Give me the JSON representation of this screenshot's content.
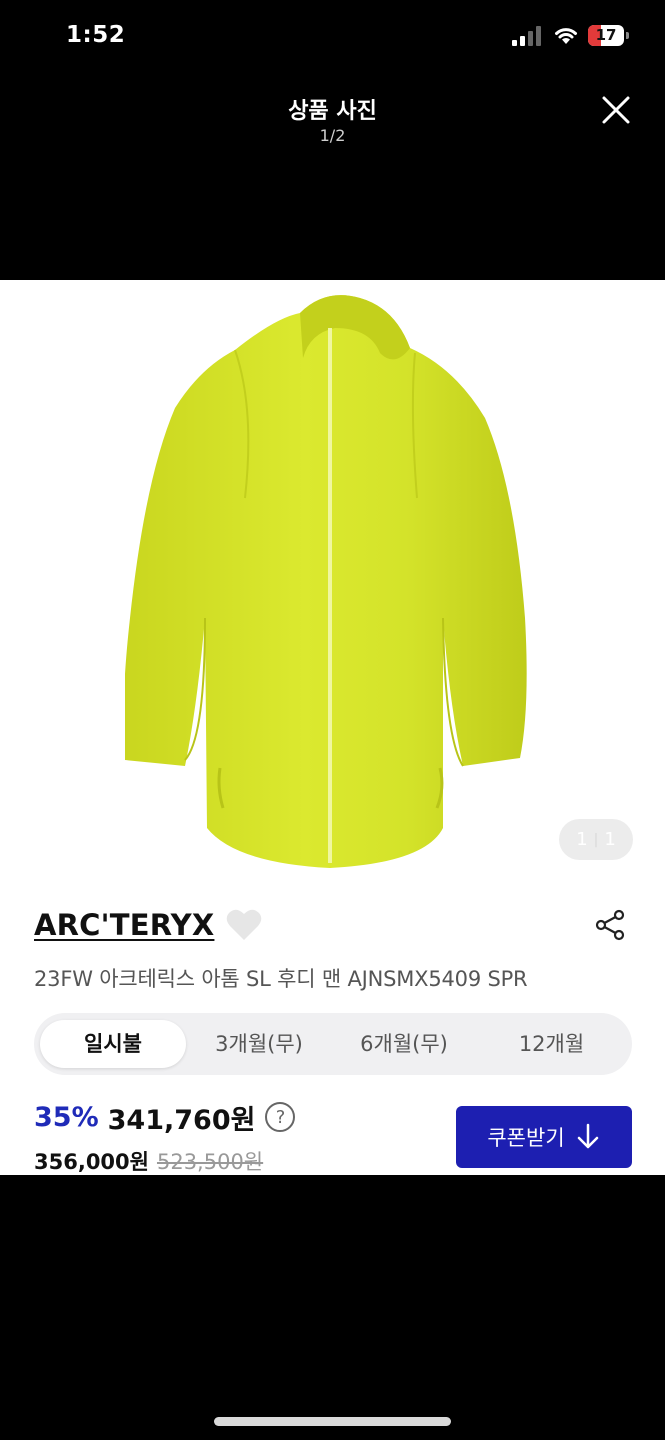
{
  "status_bar": {
    "time": "1:52",
    "battery": "17"
  },
  "viewer": {
    "title": "상품 사진",
    "counter": "1/2",
    "close_icon": "close-icon"
  },
  "product": {
    "image_counter": {
      "current": "1",
      "total": "1"
    },
    "image_color": "#d6e62a",
    "brand": "ARC'TERYX",
    "name": "23FW 아크테릭스 아톰 SL 후디 맨 AJNSMX5409 SPR",
    "payment_tabs": [
      "일시불",
      "3개월(무)",
      "6개월(무)",
      "12개월"
    ],
    "active_tab": "일시불",
    "discount": "35%",
    "sale_price": "341,760원",
    "help": "?",
    "base_price": "356,000원",
    "original_price": "523,500원",
    "coupon_button": "쿠폰받기"
  },
  "colors": {
    "accent": "#1d1fb1",
    "discount": "#1f2bb8"
  }
}
